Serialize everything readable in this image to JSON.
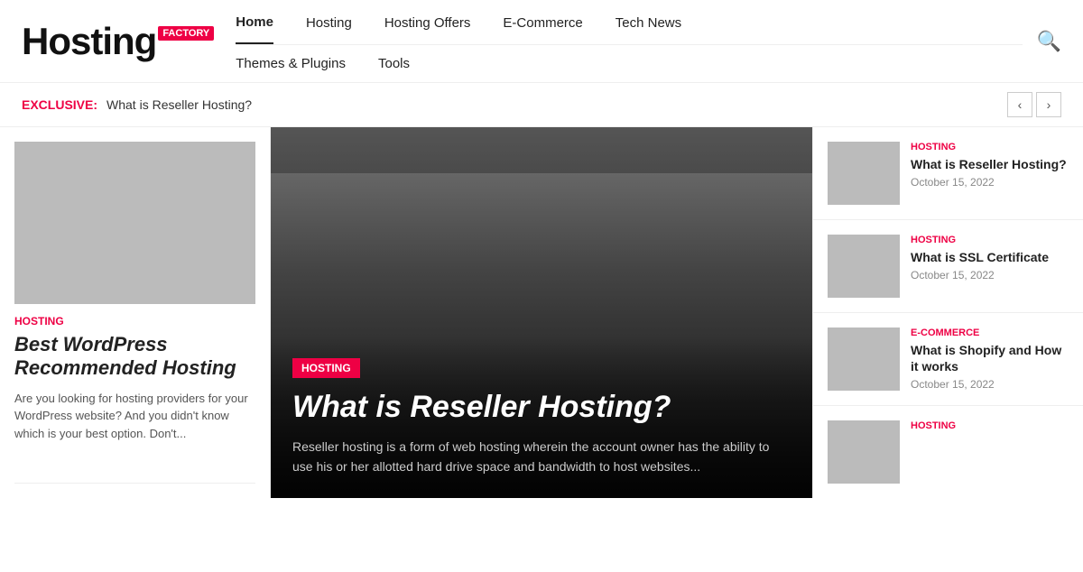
{
  "logo": {
    "text": "Hosting",
    "badge": "FACTORY"
  },
  "nav": {
    "primary": [
      {
        "label": "Home",
        "active": true
      },
      {
        "label": "Hosting",
        "active": false
      },
      {
        "label": "Hosting Offers",
        "active": false
      },
      {
        "label": "E-Commerce",
        "active": false
      },
      {
        "label": "Tech News",
        "active": false
      }
    ],
    "secondary": [
      {
        "label": "Themes & Plugins"
      },
      {
        "label": "Tools"
      }
    ]
  },
  "breaking": {
    "label": "EXCLUSIVE:",
    "text": "What is Reseller Hosting?"
  },
  "left_card": {
    "category": "HOSTING",
    "title": "Best WordPress Recommended Hosting",
    "excerpt": "Are you looking for hosting providers for your WordPress website? And you didn't know which is your best option. Don't..."
  },
  "center_card": {
    "category": "HOSTING",
    "title": "What is Reseller Hosting?",
    "excerpt": "Reseller hosting is a form of web hosting wherein the account owner has the ability to use his or her allotted hard drive space and bandwidth to host websites..."
  },
  "right_cards": [
    {
      "category": "HOSTING",
      "title": "What is Reseller Hosting?",
      "date": "October 15, 2022"
    },
    {
      "category": "HOSTING",
      "title": "What is SSL Certificate",
      "date": "October 15, 2022"
    },
    {
      "category": "E-COMMERCE",
      "title": "What is Shopify and How it works",
      "date": "October 15, 2022"
    },
    {
      "category": "HOSTING",
      "title": "",
      "date": ""
    }
  ],
  "icons": {
    "search": "&#128269;",
    "chevron_left": "&#8249;",
    "chevron_right": "&#8250;"
  }
}
